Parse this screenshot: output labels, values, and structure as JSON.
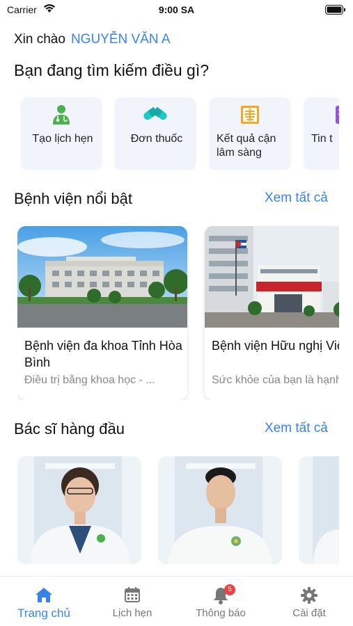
{
  "status_bar": {
    "carrier": "Carrier",
    "time": "9:00 SA"
  },
  "header": {
    "greeting": "Xin chào",
    "user_name": "NGUYỄN VĂN A",
    "question": "Bạn đang tìm kiếm điều gì?"
  },
  "services": [
    {
      "label": "Tạo lịch hẹn",
      "icon": "doctor-icon",
      "color": "#4caf50"
    },
    {
      "label": "Đơn thuốc",
      "icon": "pill-icon",
      "color": "#1ec8c8"
    },
    {
      "label": "Kết quả cận lâm sàng",
      "icon": "xray-icon",
      "color": "#f5a623"
    },
    {
      "label": "Tin t",
      "icon": "news-icon",
      "color": "#9b51e0"
    }
  ],
  "hospitals_section": {
    "title": "Bệnh viện nổi bật",
    "see_all": "Xem tất cả"
  },
  "hospitals": [
    {
      "name": "Bệnh viện đa khoa Tỉnh Hòa Bình",
      "description": "Điều trị bằng khoa học - ..."
    },
    {
      "name": "Bệnh viện Hữu nghị Việt Nam - Cuba Đồng Hới",
      "description": "Sức khỏe của bạn là hạnh phúc"
    }
  ],
  "doctors_section": {
    "title": "Bác sĩ hàng đầu",
    "see_all": "Xem tất cả"
  },
  "tab_bar": {
    "items": [
      {
        "label": "Trang chủ",
        "icon": "home-icon",
        "active": true
      },
      {
        "label": "Lịch hẹn",
        "icon": "calendar-icon",
        "active": false
      },
      {
        "label": "Thông báo",
        "icon": "bell-icon",
        "active": false,
        "badge": "5"
      },
      {
        "label": "Cài đặt",
        "icon": "gear-icon",
        "active": false
      }
    ]
  },
  "colors": {
    "accent": "#3a83e6",
    "badge": "#e94343"
  }
}
